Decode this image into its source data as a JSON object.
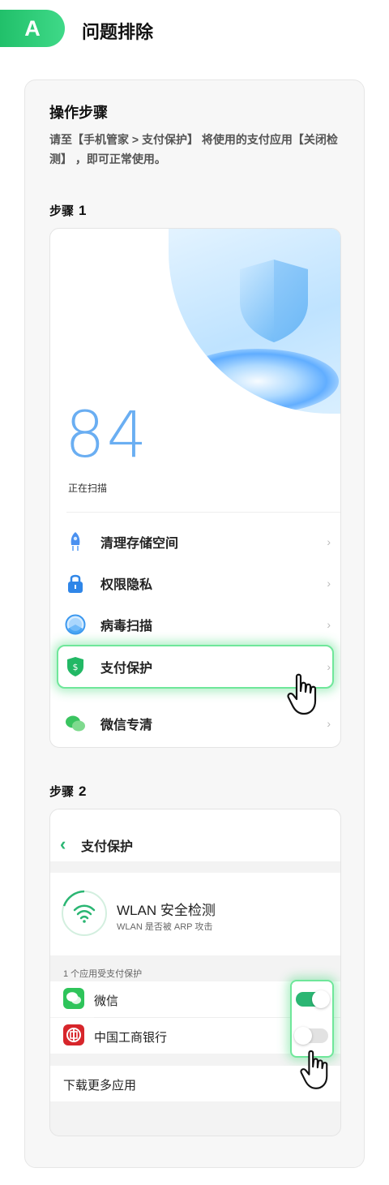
{
  "header": {
    "badge": "A",
    "title": "问题排除"
  },
  "section": {
    "title": "操作步骤",
    "description": "请至【手机管家 > 支付保护】 将使用的支付应用【关闭检测】 ，即可正常使用。"
  },
  "step1": {
    "label": "步骤",
    "number": "1",
    "score": "84",
    "score_label": "正在扫描",
    "menu": [
      {
        "label": "清理存储空间",
        "icon": "rocket-icon"
      },
      {
        "label": "权限隐私",
        "icon": "lock-icon"
      },
      {
        "label": "病毒扫描",
        "icon": "virus-scan-icon"
      },
      {
        "label": "支付保护",
        "icon": "payment-shield-icon"
      },
      {
        "label": "微信专清",
        "icon": "wechat-icon"
      }
    ],
    "chevron": "›"
  },
  "step2": {
    "label": "步骤",
    "number": "2",
    "nav_back": "‹",
    "nav_title": "支付保护",
    "wlan_title": "WLAN 安全检测",
    "wlan_subtitle": "WLAN 是否被 ARP 攻击",
    "group_label": "1 个应用受支付保护",
    "apps": [
      {
        "label": "微信",
        "enabled": true
      },
      {
        "label": "中国工商银行",
        "enabled": false
      }
    ],
    "download_more": "下载更多应用"
  },
  "colors": {
    "accent": "#2bb673",
    "highlight": "#6fe79a",
    "score": "#6aaef2"
  }
}
